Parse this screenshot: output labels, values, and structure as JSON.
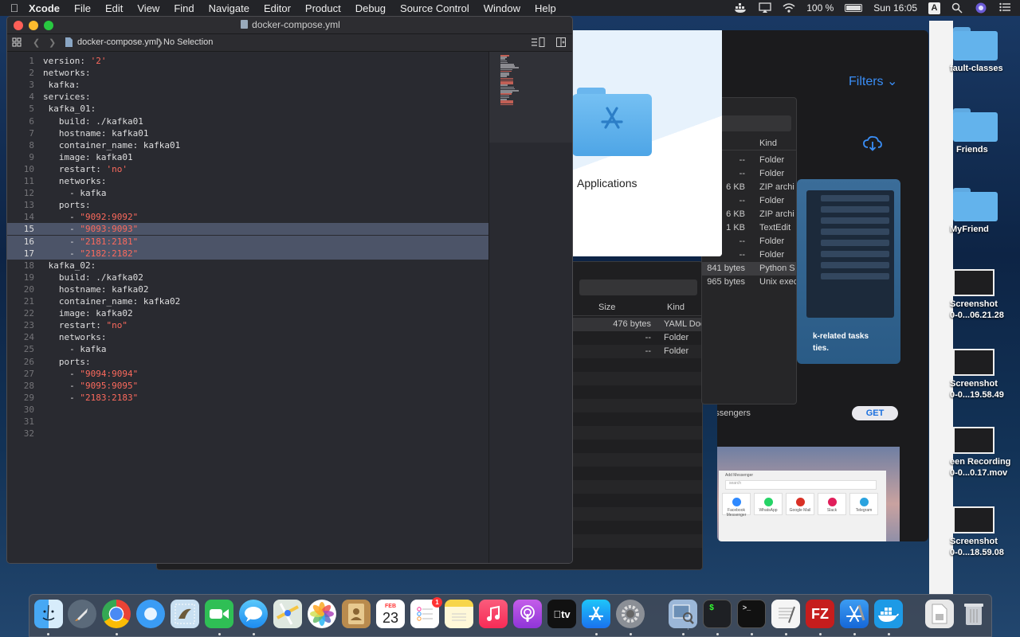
{
  "menubar": {
    "app_name": "Xcode",
    "items": [
      "File",
      "Edit",
      "View",
      "Find",
      "Navigate",
      "Editor",
      "Product",
      "Debug",
      "Source Control",
      "Window",
      "Help"
    ],
    "battery": "100 %",
    "clock": "Sun 16:05",
    "input_source": "A"
  },
  "xcode": {
    "title": "docker-compose.yml",
    "jumpbar": {
      "file": "docker-compose.yml",
      "selection": "No Selection"
    },
    "current_lines": [
      15,
      16,
      17
    ],
    "code_lines": [
      {
        "n": "1",
        "text": "version: ",
        "str": "'2'"
      },
      {
        "n": "2",
        "text": "networks:",
        "str": ""
      },
      {
        "n": "3",
        "text": " kafka:",
        "str": ""
      },
      {
        "n": "4",
        "text": "services:",
        "str": ""
      },
      {
        "n": "5",
        "text": " kafka_01:",
        "str": ""
      },
      {
        "n": "6",
        "text": "   build: ./kafka01",
        "str": ""
      },
      {
        "n": "7",
        "text": "   hostname: kafka01",
        "str": ""
      },
      {
        "n": "8",
        "text": "   container_name: kafka01",
        "str": ""
      },
      {
        "n": "9",
        "text": "   image: kafka01",
        "str": ""
      },
      {
        "n": "10",
        "text": "   restart: ",
        "str": "'no'"
      },
      {
        "n": "11",
        "text": "   networks:",
        "str": ""
      },
      {
        "n": "12",
        "text": "     - kafka",
        "str": ""
      },
      {
        "n": "13",
        "text": "   ports:",
        "str": ""
      },
      {
        "n": "14",
        "text": "     - ",
        "str": "\"9092:9092\""
      },
      {
        "n": "15",
        "text": "     - ",
        "str": "\"9093:9093\""
      },
      {
        "n": "16",
        "text": "     - ",
        "str": "\"2181:2181\""
      },
      {
        "n": "17",
        "text": "     - ",
        "str": "\"2182:2182\""
      },
      {
        "n": "18",
        "text": " kafka_02:",
        "str": ""
      },
      {
        "n": "19",
        "text": "   build: ./kafka02",
        "str": ""
      },
      {
        "n": "20",
        "text": "   hostname: kafka02",
        "str": ""
      },
      {
        "n": "21",
        "text": "   container_name: kafka02",
        "str": ""
      },
      {
        "n": "22",
        "text": "   image: kafka02",
        "str": ""
      },
      {
        "n": "23",
        "text": "   restart: ",
        "str": "\"no\""
      },
      {
        "n": "24",
        "text": "   networks:",
        "str": ""
      },
      {
        "n": "25",
        "text": "     - kafka",
        "str": ""
      },
      {
        "n": "26",
        "text": "   ports:",
        "str": ""
      },
      {
        "n": "27",
        "text": "     - ",
        "str": "\"9094:9094\""
      },
      {
        "n": "28",
        "text": "     - ",
        "str": "\"9095:9095\""
      },
      {
        "n": "29",
        "text": "     - ",
        "str": "\"2183:2183\""
      },
      {
        "n": "30",
        "text": "",
        "str": ""
      },
      {
        "n": "31",
        "text": "",
        "str": ""
      },
      {
        "n": "32",
        "text": "",
        "str": ""
      }
    ]
  },
  "applications_window": {
    "label": "Applications"
  },
  "finder_list": {
    "header_kind": "Kind",
    "rows": [
      {
        "size": "--",
        "kind": "Folder"
      },
      {
        "size": "--",
        "kind": "Folder"
      },
      {
        "size": "6 KB",
        "kind": "ZIP archi"
      },
      {
        "size": "--",
        "kind": "Folder"
      },
      {
        "size": "6 KB",
        "kind": "ZIP archi"
      },
      {
        "size": "1 KB",
        "kind": "TextEdit"
      },
      {
        "size": "--",
        "kind": "Folder"
      },
      {
        "size": "--",
        "kind": "Folder"
      },
      {
        "size": "841 bytes",
        "kind": "Python S"
      },
      {
        "size": "965 bytes",
        "kind": "Unix exec"
      }
    ]
  },
  "finder_middle": {
    "header_size": "Size",
    "header_kind": "Kind",
    "rows": [
      {
        "size": "476 bytes",
        "kind": "YAML Doc"
      },
      {
        "size": "--",
        "kind": "Folder"
      },
      {
        "size": "--",
        "kind": "Folder"
      }
    ]
  },
  "appstore": {
    "filters": "Filters",
    "promo_text_1": "k-related tasks",
    "promo_text_2": "ties.",
    "messengers": "Messengers",
    "get": "GET",
    "messenger_search": "search",
    "messenger_title": "Add Messenger",
    "messenger_apps": [
      "Facebook Messenger",
      "WhatsApp",
      "Google Mail",
      "Slack",
      "Telegram"
    ]
  },
  "desktop": {
    "items": [
      {
        "label": "fault-classes"
      },
      {
        "label": "Friends"
      },
      {
        "label": "MyFriend"
      },
      {
        "label": "Screenshot\n0-0...06.21.28"
      },
      {
        "label": "Screenshot\n0-0...19.58.49"
      },
      {
        "label": "een Recording\n0-0...0.17.mov"
      },
      {
        "label": "Screenshot\n0-0...18.59.08"
      }
    ]
  },
  "dock": {
    "calendar_month": "FEB",
    "calendar_day": "23",
    "reminders_badge": "1",
    "tv_label": "tv",
    "terminal_prompt": ">_",
    "filezilla": "FZ"
  }
}
